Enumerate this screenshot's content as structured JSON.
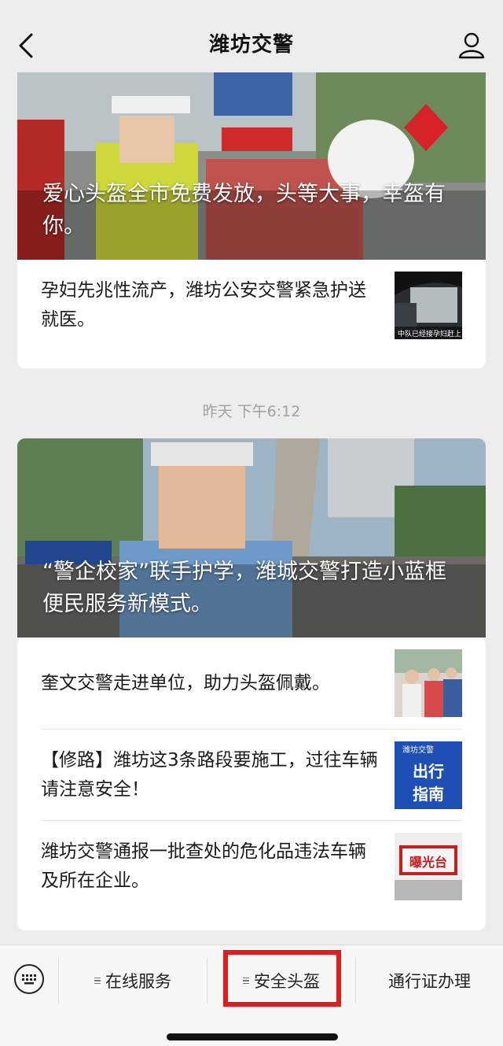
{
  "nav": {
    "title": "潍坊交警"
  },
  "card1": {
    "hero_title": "爱心头盔全市免费发放，头等大事，幸盔有你。",
    "items": [
      {
        "title": "孕妇先兆性流产，潍坊公安交警紧急护送就医。",
        "thumb_caption": "中队已经接孕妇赶上"
      }
    ]
  },
  "timestamp": "昨天 下午6:12",
  "card2": {
    "hero_title": "“警企校家”联手护学，潍城交警打造小蓝框便民服务新模式。",
    "items": [
      {
        "title": "奎文交警走进单位，助力头盔佩戴。"
      },
      {
        "title": "【修路】潍坊这3条路段要施工，过往车辆请注意安全！",
        "thumb_top": "潍坊交警",
        "thumb_main": "出行指南",
        "thumb_line1": "出行",
        "thumb_line2": "指南"
      },
      {
        "title": "潍坊交警通报一批查处的危化品违法车辆及所在企业。",
        "thumb_label": "曝光台"
      }
    ]
  },
  "menu": {
    "items": [
      {
        "label": "在线服务",
        "has_submenu": true
      },
      {
        "label": "安全头盔",
        "has_submenu": true,
        "highlighted": true
      },
      {
        "label": "通行证办理",
        "has_submenu": false
      }
    ],
    "highlight_color": "#e01c1c"
  },
  "icons": [
    "chevron-left-icon",
    "user-icon",
    "keyboard-icon",
    "menu-lines-icon"
  ]
}
